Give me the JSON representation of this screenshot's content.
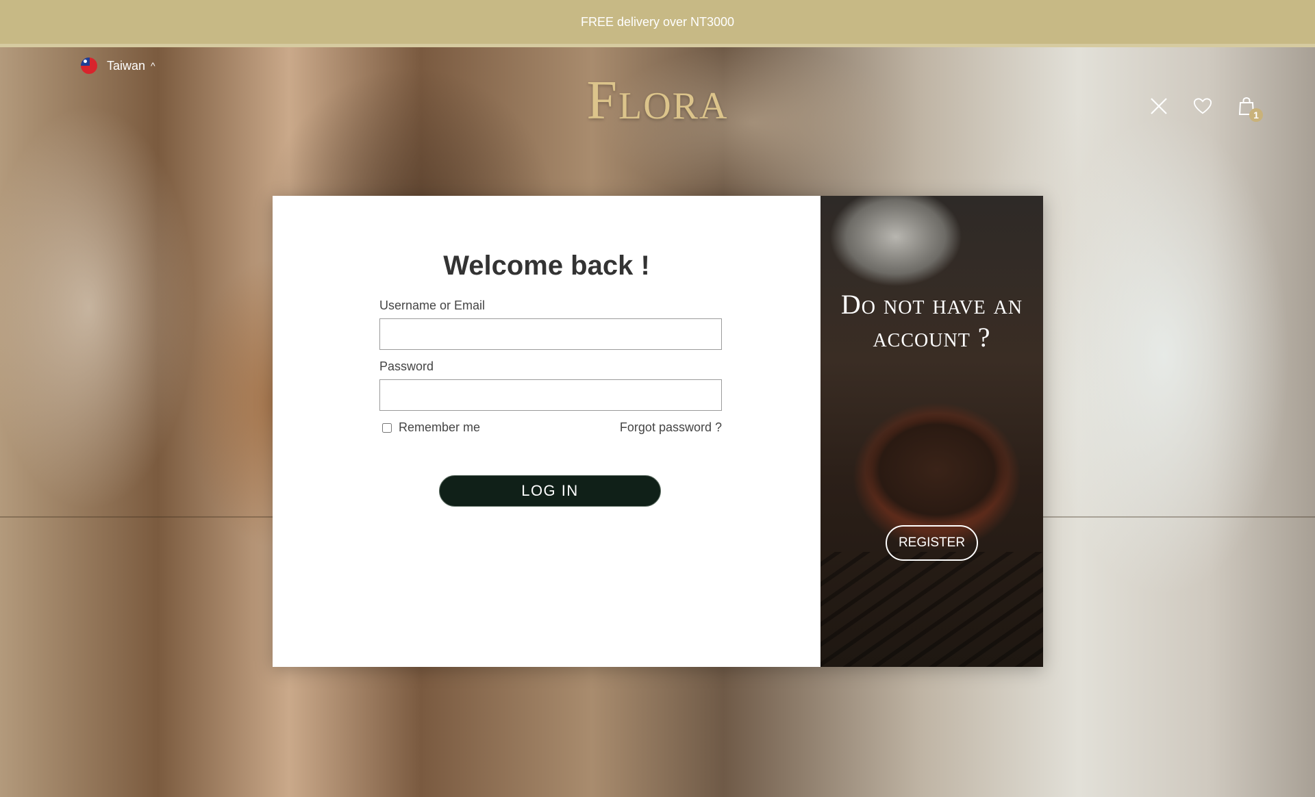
{
  "announcement": {
    "text": "FREE delivery over NT3000"
  },
  "header": {
    "region": {
      "label": "Taiwan",
      "chevron": "^",
      "flag_icon": "taiwan-flag-icon"
    },
    "logo": "Flora",
    "icons": {
      "close": "close-icon",
      "wishlist": "heart-icon",
      "cart": "shopping-bag-icon"
    },
    "cart_count": "1"
  },
  "login": {
    "title": "Welcome back !",
    "username_label": "Username or Email",
    "username_value": "",
    "password_label": "Password",
    "password_value": "",
    "remember_label": "Remember me",
    "remember_checked": false,
    "forgot_label": "Forgot password ?",
    "submit_label": "LOG IN"
  },
  "register": {
    "title": "Do not have an account ?",
    "button_label": "REGISTER"
  },
  "colors": {
    "announcement_bar": "#c7b985",
    "logo": "#dcc48b",
    "login_button": "#102018",
    "badge": "#c9b27a"
  }
}
